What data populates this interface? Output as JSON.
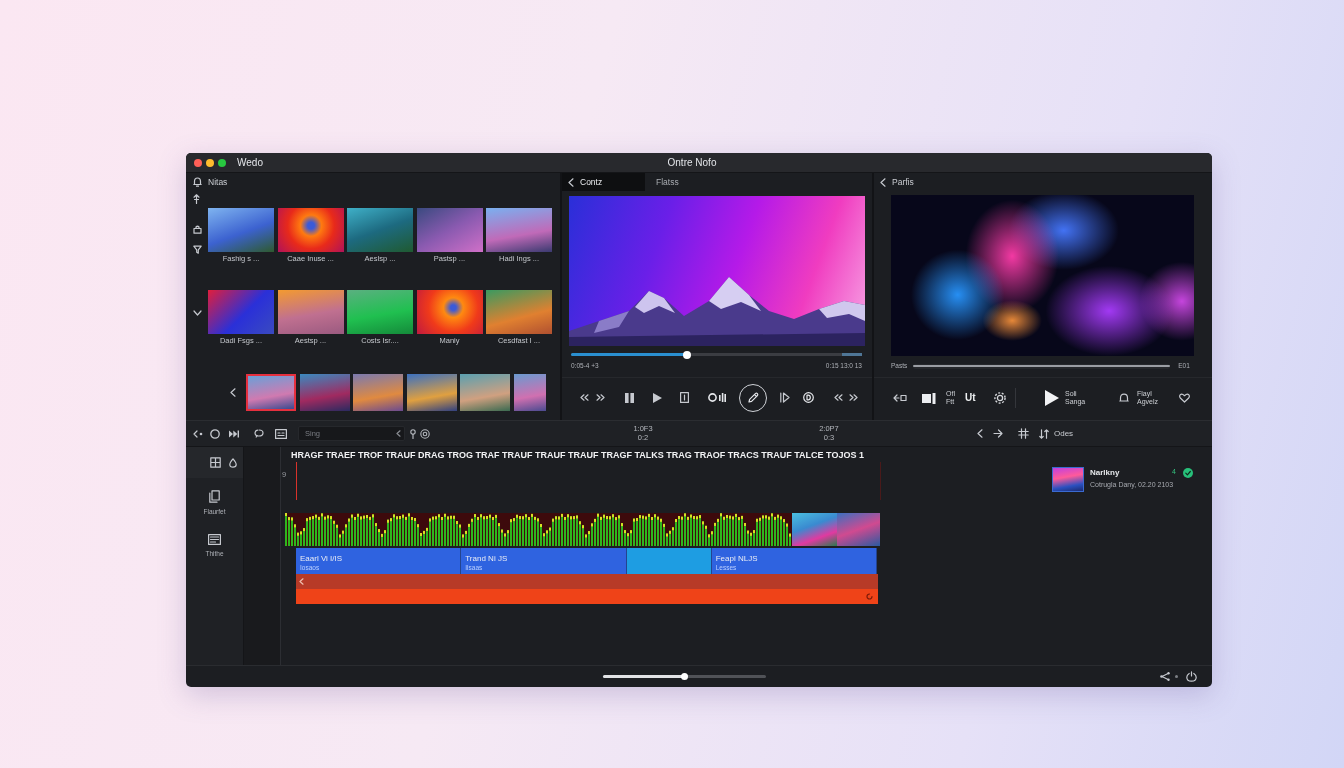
{
  "window": {
    "app_name": "Wedo",
    "title": "Ontre Nofo"
  },
  "media_panel": {
    "title": "Nitas",
    "grid": [
      {
        "caption": "Fashig s ..."
      },
      {
        "caption": "Caae Inuse ..."
      },
      {
        "caption": "Aeslsp ..."
      },
      {
        "caption": "Pastsp ..."
      },
      {
        "caption": "Hadi Ings ..."
      },
      {
        "caption": "Dadi Fsgs ..."
      },
      {
        "caption": "Aestsp ..."
      },
      {
        "caption": "Costs Isr...."
      },
      {
        "caption": "Maniy"
      },
      {
        "caption": "Cesdfast I ..."
      }
    ],
    "strip": [
      {
        "selected": true
      },
      {
        "selected": false
      },
      {
        "selected": false
      },
      {
        "selected": false
      },
      {
        "selected": false
      },
      {
        "selected": false
      }
    ]
  },
  "preview": {
    "tabs": [
      {
        "label": "Contz",
        "selected": true
      },
      {
        "label": "Flatss",
        "selected": false
      }
    ],
    "progress": {
      "level": 0.4
    },
    "time_start": "0:05-4 +3",
    "time_end": "0:15 13:0 13"
  },
  "player": {
    "back_label": "Parfis",
    "progress_label": "Pasts",
    "progress": {
      "level": 1
    },
    "progress_end": "E01",
    "audio_label": "Ofl\nFtt",
    "text_label": "Ut",
    "play_label": "Soli\nSanga",
    "alerts_label": "Flayl\nAgvelz"
  },
  "timeline": {
    "search": {
      "placeholder": "Sing"
    },
    "timestamps": [
      {
        "time": "1:0F3",
        "sub": "0:2"
      },
      {
        "time": "2:0P7",
        "sub": "0:3"
      }
    ],
    "sort_label": "Odes",
    "tools": [
      {
        "kind": "documents",
        "label": "Flaurfet"
      },
      {
        "kind": "list",
        "label": "Thithe"
      }
    ],
    "row_number": "9",
    "track_header": "HRAGF TRAEF TROF TRAUF DRAG TROG TRAF TRAUF TRAUF TRAUF TRAGF TALKS TRAG TRAOF TRACS TRAUF TALCE TOJOS 1",
    "clips": [
      {
        "kind": "clip",
        "title": "Eaarl Vi I/IS",
        "subtitle": "Iosaos"
      },
      {
        "kind": "clip",
        "title": "Trand Ni JS",
        "subtitle": "Ilsaas"
      },
      {
        "kind": "blank"
      },
      {
        "kind": "clip",
        "title": "Feapi NLJS",
        "subtitle": "Lesses"
      }
    ]
  },
  "info_card": {
    "title": "Narlkny",
    "count": "4",
    "subtitle": "Cotrugla Dany, 02.20 2103"
  },
  "zoom_slider": {
    "level": 0.5
  }
}
